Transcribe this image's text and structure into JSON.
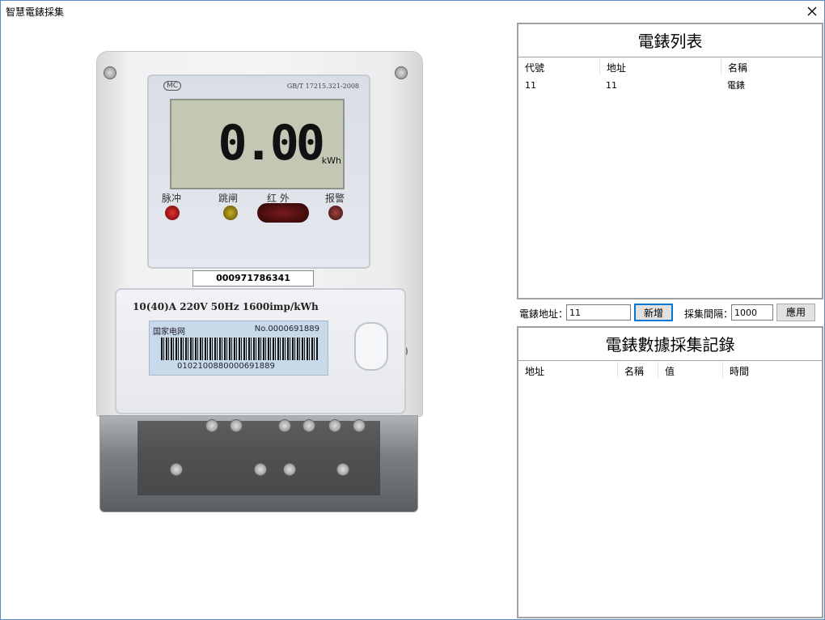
{
  "window": {
    "title": "智慧電錶採集",
    "close_glyph": "×"
  },
  "meter": {
    "lcd_value": "0.00",
    "lcd_unit": "kWh",
    "logo": "MC",
    "standard": "GB/T 17215.321-2008",
    "leds": {
      "pulse": "脉冲",
      "trip": "跳闸",
      "infrared": "红  外",
      "alarm": "报警"
    },
    "serial": "000971786341",
    "rating": "10(40)A  220V  50Hz  1600imp/kWh",
    "grid_company": "国家电网",
    "label_no": "No.0000691889",
    "barcode_number": "0102100880000691889"
  },
  "meter_list": {
    "title": "電錶列表",
    "columns": [
      "代號",
      "地址",
      "名稱"
    ],
    "rows": [
      {
        "code": "11",
        "address": "11",
        "name": "電錶"
      }
    ]
  },
  "controls": {
    "address_label": "電錶地址：",
    "address_value": "11",
    "add_button": "新增",
    "interval_label": "採集間隔：",
    "interval_value": "1000",
    "apply_button": "應用"
  },
  "records": {
    "title": "電錶數據採集記錄",
    "columns": [
      "地址",
      "名稱",
      "值",
      "時間"
    ],
    "rows": []
  }
}
